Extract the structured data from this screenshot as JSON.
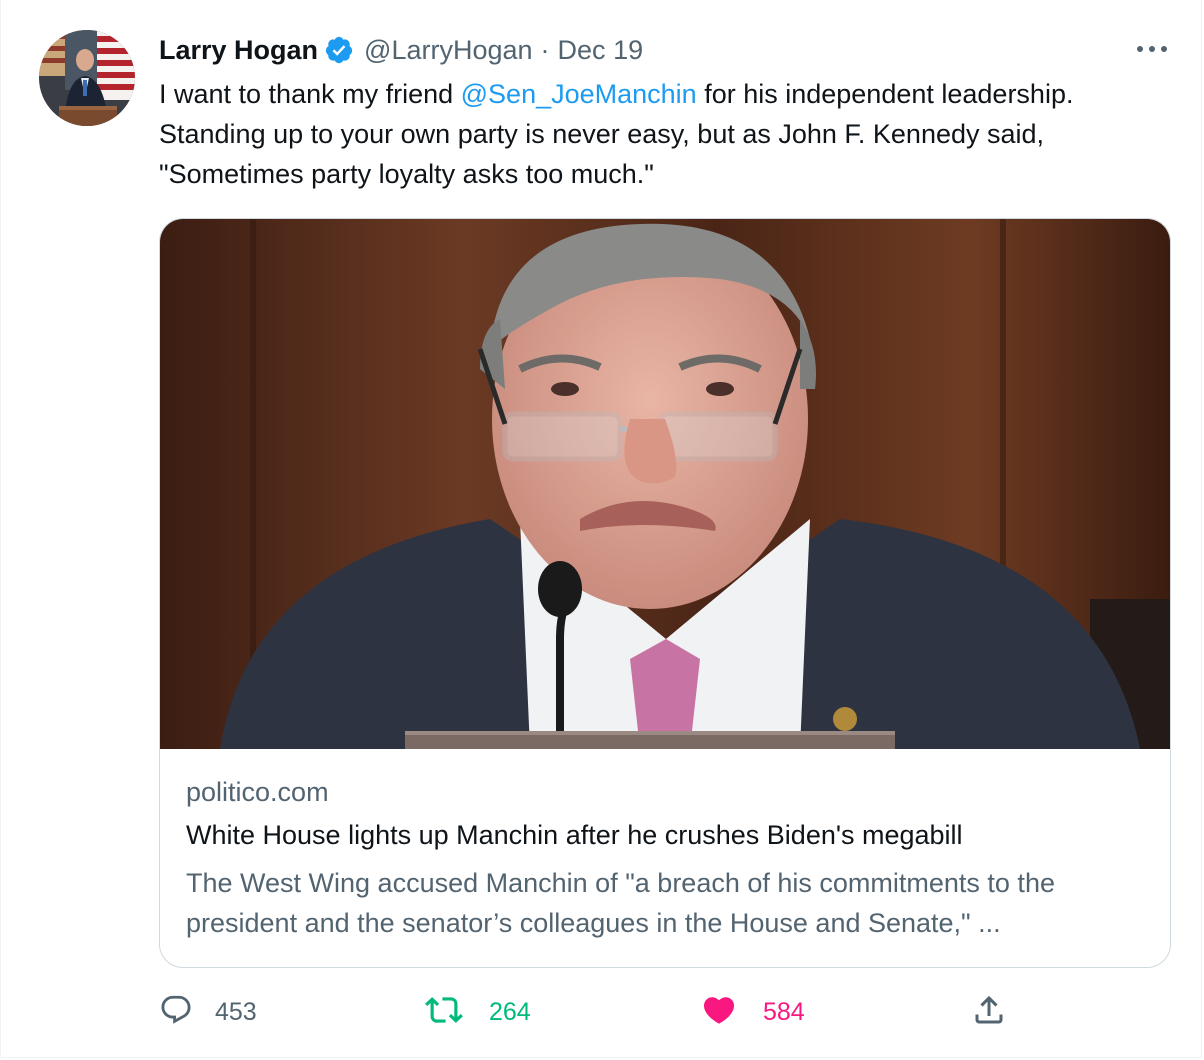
{
  "author": {
    "name": "Larry Hogan",
    "handle": "@LarryHogan",
    "separator": "·",
    "date": "Dec 19",
    "verified": true
  },
  "tweet": {
    "text_before": "I want to thank my friend ",
    "mention": "@Sen_JoeManchin",
    "text_after": " for his independent leadership. Standing up to your own party is never easy, but as John F. Kennedy said, \"Sometimes party loyalty asks too much.\""
  },
  "card": {
    "domain": "politico.com",
    "title": "White House lights up Manchin after he crushes Biden's megabill",
    "description": "The West Wing accused Manchin of \"a breach of his commitments to the president and the senator’s colleagues in the House and Senate,\" ..."
  },
  "actions": {
    "replies": "453",
    "retweets": "264",
    "likes": "584"
  },
  "icons": {
    "more": "more-icon",
    "verified": "verified-badge-icon",
    "reply": "reply-icon",
    "retweet": "retweet-icon",
    "like": "heart-icon",
    "share": "share-icon"
  },
  "colors": {
    "accent": "#1d9bf0",
    "retweet": "#00ba7c",
    "like": "#f91880",
    "muted": "#536471",
    "border": "#cfd9de"
  }
}
